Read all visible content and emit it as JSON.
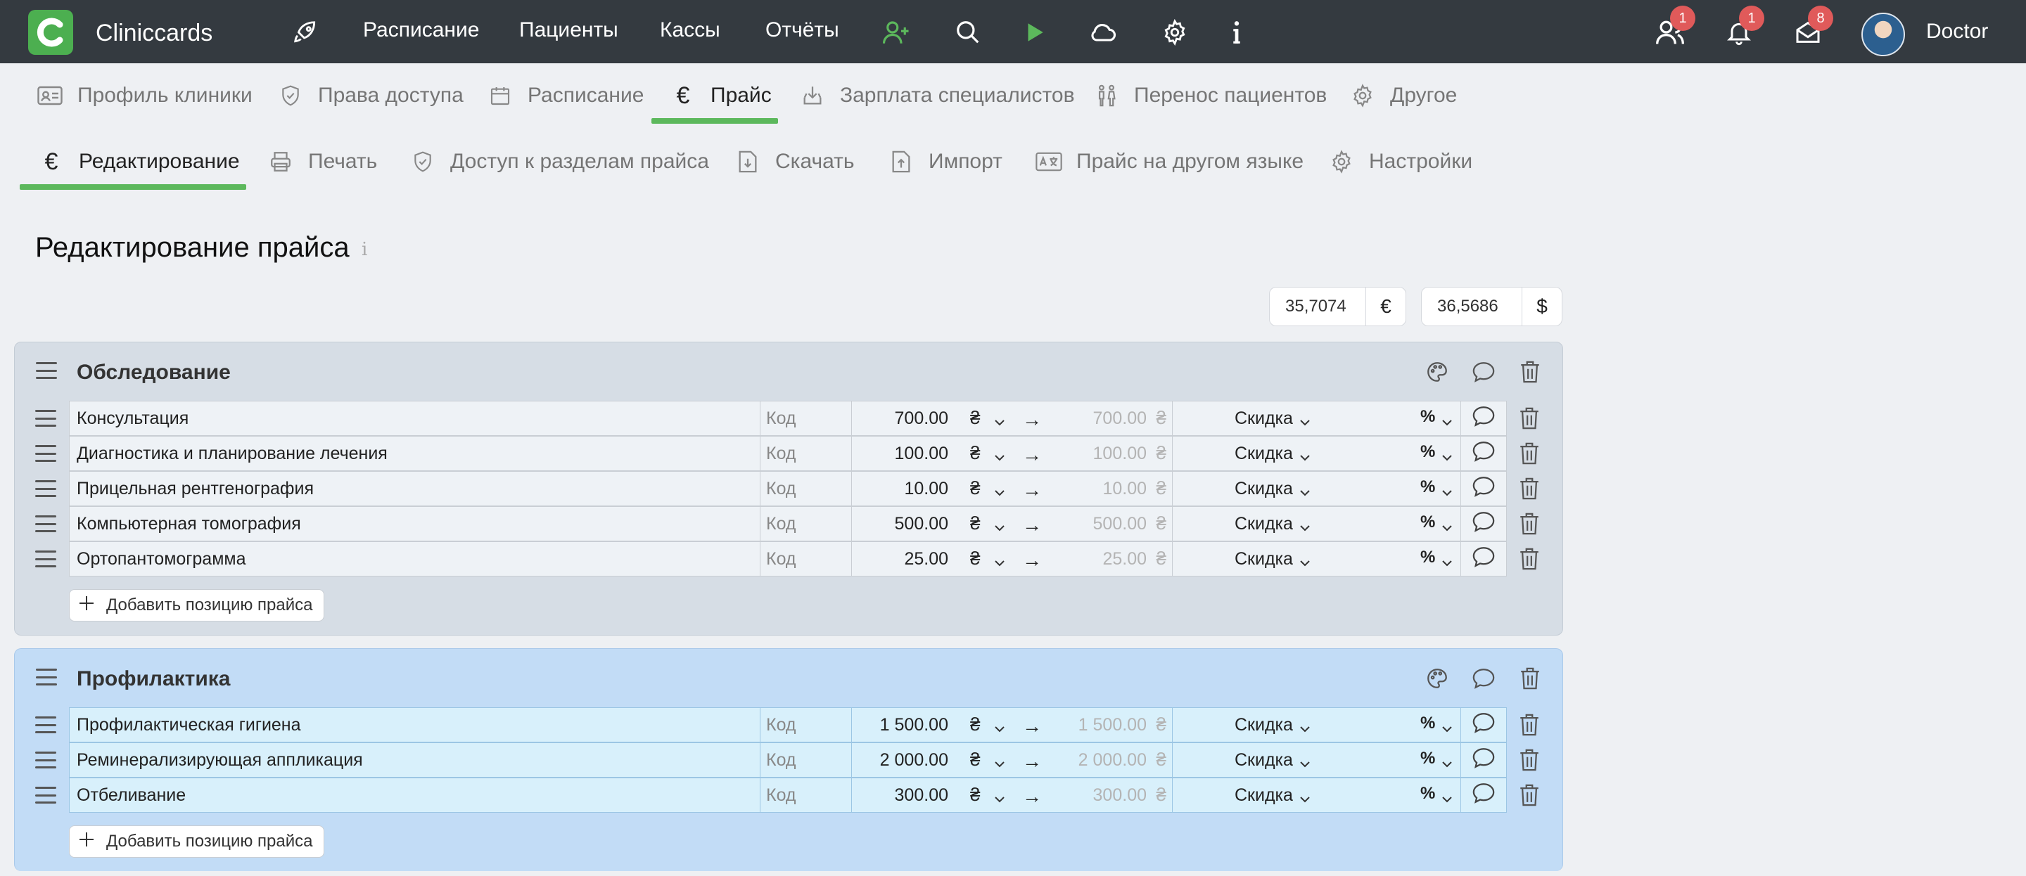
{
  "app": {
    "name": "Cliniccards",
    "user_name": "Doctor"
  },
  "navbar": {
    "links": [
      "Расписание",
      "Пациенты",
      "Кассы",
      "Отчёты"
    ],
    "badges": {
      "users": "1",
      "notifications": "1",
      "messages": "8"
    }
  },
  "tabs": [
    "Профиль клиники",
    "Права доступа",
    "Расписание",
    "Прайс",
    "Зарплата специалистов",
    "Перенос пациентов",
    "Другое"
  ],
  "subtabs": [
    "Редактирование",
    "Печать",
    "Доступ к разделам прайса",
    "Скачать",
    "Импорт",
    "Прайс на другом языке",
    "Настройки"
  ],
  "page": {
    "title": "Редактирование прайса",
    "info_glyph": "i"
  },
  "currency": {
    "eur_rate": "35,7074",
    "eur_symbol": "€",
    "usd_rate": "36,5686",
    "usd_symbol": "$"
  },
  "common": {
    "code_placeholder": "Код",
    "discount_label": "Скидка",
    "percent_symbol": "%",
    "currency_glyph": "₴",
    "arrow": "→",
    "add_item_label": "Добавить позицию прайса"
  },
  "groups": [
    {
      "title": "Обследование",
      "items": [
        {
          "name": "Консультация",
          "price": "700.00",
          "final_price": "700.00"
        },
        {
          "name": "Диагностика и планирование лечения",
          "price": "100.00",
          "final_price": "100.00"
        },
        {
          "name": "Прицельная рентгенография",
          "price": "10.00",
          "final_price": "10.00"
        },
        {
          "name": "Компьютерная томография",
          "price": "500.00",
          "final_price": "500.00"
        },
        {
          "name": "Ортопантомограмма",
          "price": "25.00",
          "final_price": "25.00"
        }
      ]
    },
    {
      "title": "Профилактика",
      "items": [
        {
          "name": "Профилактическая гигиена",
          "price": "1 500.00",
          "final_price": "1 500.00"
        },
        {
          "name": "Реминерализирующая аппликация",
          "price": "2 000.00",
          "final_price": "2 000.00"
        },
        {
          "name": "Отбеливание",
          "price": "300.00",
          "final_price": "300.00"
        }
      ]
    }
  ]
}
